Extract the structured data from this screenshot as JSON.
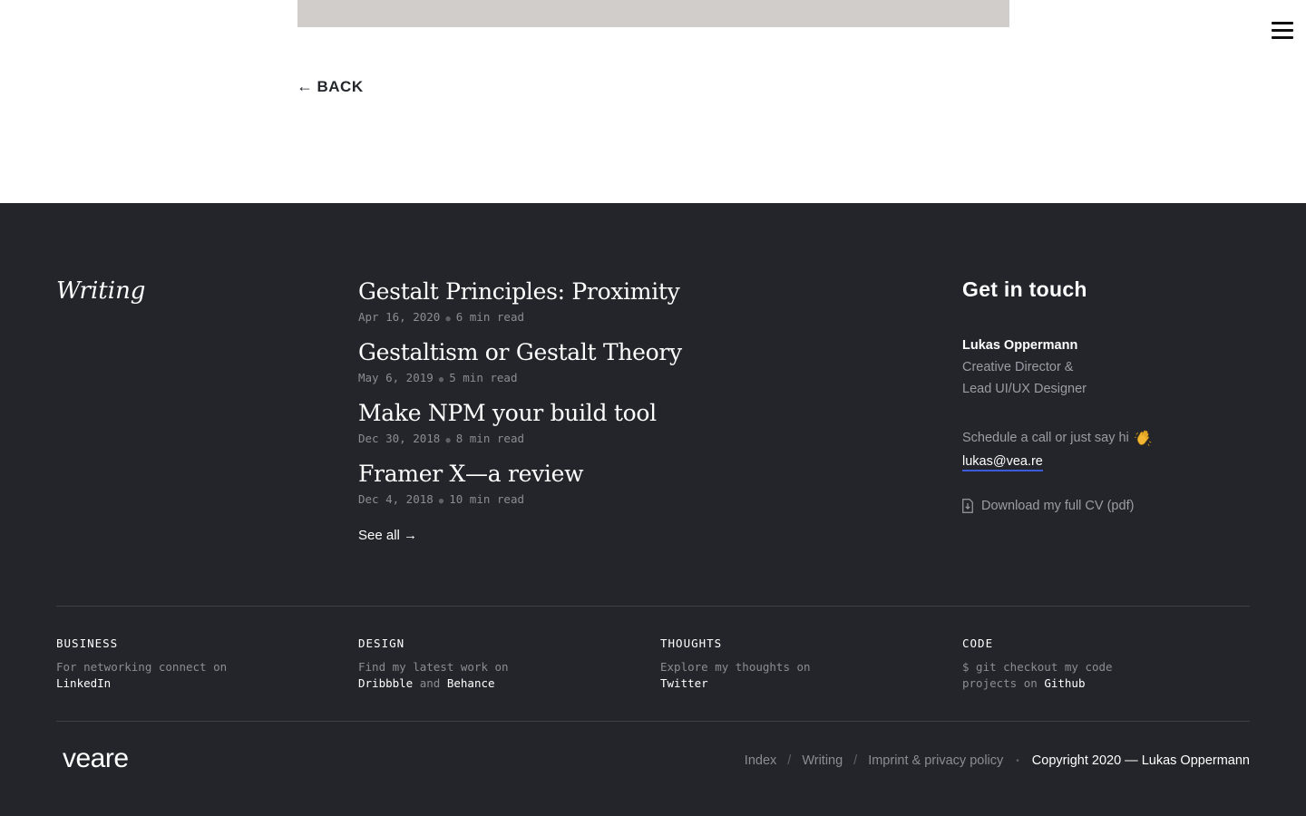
{
  "header": {
    "back_label": "BACK",
    "back_arrow": "←"
  },
  "writing": {
    "heading": "Writing",
    "articles": [
      {
        "title": "Gestalt Principles: Proximity",
        "date": "Apr 16, 2020",
        "read_time": "6 min read"
      },
      {
        "title": "Gestaltism or Gestalt Theory",
        "date": "May 6, 2019",
        "read_time": "5 min read"
      },
      {
        "title": "Make NPM your build tool",
        "date": "Dec 30, 2018",
        "read_time": "8 min read"
      },
      {
        "title": "Framer X—a review",
        "date": "Dec 4, 2018",
        "read_time": "10 min read"
      }
    ],
    "see_all": "See all →"
  },
  "contact": {
    "heading": "Get in touch",
    "name": "Lukas Oppermann",
    "role_line1": "Creative Director &",
    "role_line2": "Lead UI/UX Designer",
    "schedule_text": "Schedule a call or just say hi",
    "email": "lukas@vea.re",
    "cv_label": "Download my full CV (pdf)"
  },
  "links": {
    "business": {
      "label": "BUSINESS",
      "text": "For networking connect on",
      "link": "LinkedIn"
    },
    "design": {
      "label": "DESIGN",
      "text": "Find my latest work on",
      "link1": "Dribbble",
      "joiner": "and",
      "link2": "Behance"
    },
    "thoughts": {
      "label": "THOUGHTS",
      "text": "Explore my thoughts on",
      "link": "Twitter"
    },
    "code": {
      "label": "CODE",
      "text": "$ git checkout my code projects on",
      "link": "Github"
    }
  },
  "bottom": {
    "logo": "veare",
    "nav": [
      "Index",
      "Writing",
      "Imprint & privacy policy"
    ],
    "separator": "/",
    "bullet": "•",
    "copyright": "Copyright 2020 — Lukas Oppermann"
  },
  "colors": {
    "footer_bg": "#23252a",
    "hero_placeholder": "#d1cdca",
    "email_underline": "#3b5bdb"
  }
}
